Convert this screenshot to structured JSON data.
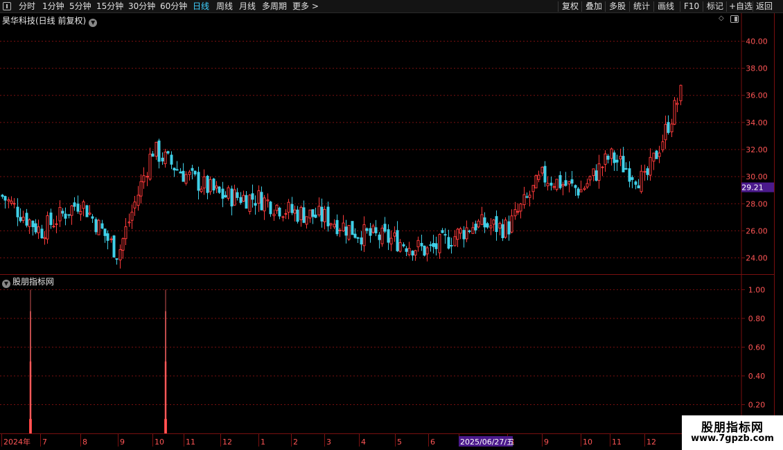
{
  "toolbar": {
    "left": [
      "分时",
      "1分钟",
      "5分钟",
      "15分钟",
      "30分钟",
      "60分钟",
      "日线",
      "周线",
      "月线",
      "多周期",
      "更多 >"
    ],
    "active": "日线",
    "right": [
      "复权",
      "叠加",
      "多股",
      "统计",
      "画线",
      "F10",
      "标记",
      "+自选",
      "返回"
    ]
  },
  "main_chart": {
    "title": "昊华科技(日线 前复权)",
    "price_ticks": [
      "40.00",
      "38.00",
      "36.00",
      "34.00",
      "32.00",
      "30.00",
      "28.00",
      "26.00",
      "24.00"
    ],
    "current_price": "29.21"
  },
  "indicator": {
    "title": "股朋指标网",
    "ticks": [
      "1.00",
      "0.80",
      "0.60",
      "0.40",
      "0.20"
    ]
  },
  "time_axis": {
    "labels": [
      "2024年",
      "7",
      "8",
      "9",
      "10",
      "11",
      "12",
      "1",
      "2",
      "3",
      "4",
      "5",
      "6",
      "7",
      "8",
      "9",
      "10",
      "11",
      "12"
    ],
    "cursor_date": "2025/06/27/五"
  },
  "watermark": {
    "title": "股朋指标网",
    "url": "www.7gpzb.com"
  },
  "colors": {
    "up": "#ff3a3a",
    "down": "#3fd0e8",
    "grid": "#7a1010",
    "accent": "#3fd0ff",
    "highlight": "#4b1a8c"
  },
  "chart_data": [
    {
      "type": "candlestick",
      "title": "昊华科技(日线 前复权)",
      "y_ticks": [
        24,
        26,
        28,
        30,
        32,
        34,
        36,
        38,
        40
      ],
      "ylim": [
        22.8,
        41.2
      ],
      "current_price": 29.21,
      "monthly_close": [
        {
          "month": "2024-06",
          "value": 28.6
        },
        {
          "month": "2024-07",
          "value": 26.0
        },
        {
          "month": "2024-08",
          "value": 28.2
        },
        {
          "month": "2024-09",
          "value": 24.3
        },
        {
          "month": "2024-10",
          "value": 32.0
        },
        {
          "month": "2024-11",
          "value": 30.2
        },
        {
          "month": "2024-12",
          "value": 28.6
        },
        {
          "month": "2025-01",
          "value": 28.4
        },
        {
          "month": "2025-02",
          "value": 27.4
        },
        {
          "month": "2025-03",
          "value": 27.0
        },
        {
          "month": "2025-04",
          "value": 25.8
        },
        {
          "month": "2025-05",
          "value": 25.3
        },
        {
          "month": "2025-06",
          "value": 24.5
        },
        {
          "month": "2025-07",
          "value": 26.5
        },
        {
          "month": "2025-08",
          "value": 26.2
        },
        {
          "month": "2025-09",
          "value": 30.0
        },
        {
          "month": "2025-10",
          "value": 29.0
        },
        {
          "month": "2025-11",
          "value": 31.5
        },
        {
          "month": "2025-12",
          "value": 29.6
        },
        {
          "month": "2026-01",
          "value": 36.5
        }
      ]
    },
    {
      "type": "bar",
      "title": "股朋指标网",
      "y_ticks": [
        0.2,
        0.4,
        0.6,
        0.8,
        1.0
      ],
      "ylim": [
        0,
        1.05
      ],
      "signals": [
        {
          "date": "2024-07-01",
          "value": 1.0
        },
        {
          "date": "2024-10-08",
          "value": 1.0
        }
      ]
    }
  ]
}
